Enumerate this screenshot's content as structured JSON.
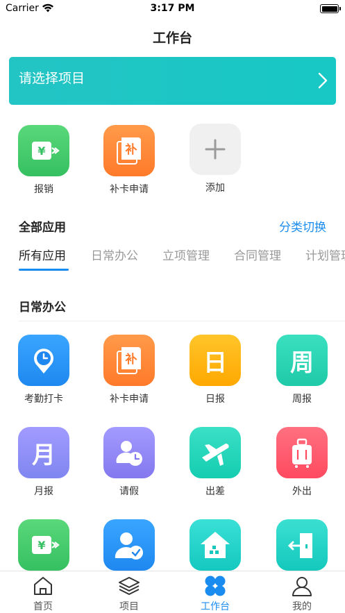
{
  "status": {
    "carrier": "Carrier",
    "time": "3:17 PM"
  },
  "nav": {
    "title": "工作台"
  },
  "project": {
    "placeholder": "请选择项目"
  },
  "quick_apps": [
    {
      "label": "报销",
      "icon": "reimburse-icon",
      "color": "#43c96a"
    },
    {
      "label": "补卡申请",
      "icon": "card-supplement-icon",
      "color": "#ff8a3a"
    },
    {
      "label": "添加",
      "icon": "add-icon",
      "color": "#f0f0f0"
    }
  ],
  "all_apps": {
    "title": "全部应用",
    "switch_label": "分类切换"
  },
  "tabs": [
    "所有应用",
    "日常办公",
    "立项管理",
    "合同管理",
    "计划管理"
  ],
  "group": {
    "title": "日常办公",
    "apps": [
      {
        "label": "考勤打卡",
        "icon": "clock-location-icon",
        "color": "#2196f3"
      },
      {
        "label": "补卡申请",
        "icon": "card-supplement-icon",
        "color": "#ff8a3a"
      },
      {
        "label": "日报",
        "icon": "daily-report-icon",
        "color": "#ffb300",
        "glyph": "日"
      },
      {
        "label": "周报",
        "icon": "weekly-report-icon",
        "color": "#25d4b0",
        "glyph": "周"
      },
      {
        "label": "月报",
        "icon": "monthly-report-icon",
        "color": "#8c8cf5",
        "glyph": "月"
      },
      {
        "label": "请假",
        "icon": "leave-icon",
        "color": "#8f86f3"
      },
      {
        "label": "出差",
        "icon": "airplane-icon",
        "color": "#1fd3b7"
      },
      {
        "label": "外出",
        "icon": "luggage-icon",
        "color": "#ff5a6e"
      },
      {
        "label": "",
        "icon": "reimburse-icon",
        "color": "#43c96a"
      },
      {
        "label": "",
        "icon": "user-check-icon",
        "color": "#2196f3"
      },
      {
        "label": "",
        "icon": "house-icon",
        "color": "#1fd3c7"
      },
      {
        "label": "",
        "icon": "door-exit-icon",
        "color": "#25d4c2"
      }
    ]
  },
  "tabbar": [
    {
      "label": "首页",
      "icon": "home-icon"
    },
    {
      "label": "项目",
      "icon": "layers-icon"
    },
    {
      "label": "工作台",
      "icon": "workbench-icon",
      "active": true
    },
    {
      "label": "我的",
      "icon": "user-icon"
    }
  ],
  "colors": {
    "accent": "#1a8cf0",
    "banner": "#17c8c5"
  }
}
